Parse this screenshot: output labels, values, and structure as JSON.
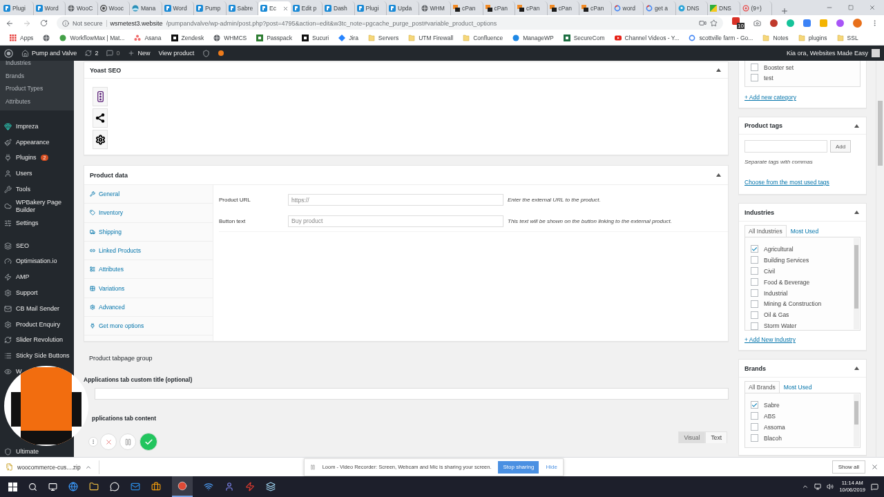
{
  "browser": {
    "tabs": [
      {
        "label": "Plugi",
        "kind": "p",
        "selected": false
      },
      {
        "label": "Word",
        "kind": "p",
        "selected": false
      },
      {
        "label": "WooC",
        "kind": "globe",
        "selected": false
      },
      {
        "label": "Wooc",
        "kind": "wp",
        "selected": false
      },
      {
        "label": "Mana",
        "kind": "disc",
        "selected": false
      },
      {
        "label": "Word",
        "kind": "p",
        "selected": false
      },
      {
        "label": "Pump",
        "kind": "p",
        "selected": false
      },
      {
        "label": "Sabre",
        "kind": "p",
        "selected": false
      },
      {
        "label": "Ec",
        "kind": "p",
        "selected": true
      },
      {
        "label": "Edit p",
        "kind": "p",
        "selected": false
      },
      {
        "label": "Dash",
        "kind": "p",
        "selected": false
      },
      {
        "label": "Plugi",
        "kind": "p",
        "selected": false
      },
      {
        "label": "Upda",
        "kind": "p",
        "selected": false
      },
      {
        "label": "WHM",
        "kind": "globe",
        "selected": false
      },
      {
        "label": "cPan",
        "kind": "cpanel",
        "selected": false
      },
      {
        "label": "cPan",
        "kind": "cpanel",
        "selected": false
      },
      {
        "label": "cPan",
        "kind": "cpanel",
        "selected": false
      },
      {
        "label": "cPan",
        "kind": "cpanel",
        "selected": false
      },
      {
        "label": "cPan",
        "kind": "cpanel",
        "selected": false
      },
      {
        "label": "word",
        "kind": "google",
        "selected": false
      },
      {
        "label": "get a",
        "kind": "google",
        "selected": false
      },
      {
        "label": "DNS",
        "kind": "pin",
        "selected": false
      },
      {
        "label": "DNS",
        "kind": "flag",
        "selected": false
      },
      {
        "label": "(9+)",
        "kind": "ring",
        "selected": false
      }
    ],
    "address": {
      "security": "Not secure",
      "host": "wsmetest3.website",
      "path": "/pumpandvalve/wp-admin/post.php?post=4795&action=edit&w3tc_note=pgcache_purge_post#variable_product_options"
    },
    "extension_badge": "10",
    "bookmarks": [
      {
        "label": "Apps",
        "kind": "grid",
        "color": "#e53935"
      },
      {
        "kind": "globe",
        "color": "#5f6368"
      },
      {
        "label": "WorkflowMax | Mat...",
        "kind": "dot",
        "color": "#43a047"
      },
      {
        "label": "Asana",
        "kind": "dots",
        "color": "#f06a6a"
      },
      {
        "label": "Zendesk",
        "kind": "square",
        "color": "#111111"
      },
      {
        "label": "WHMCS",
        "kind": "globe",
        "color": "#5f6368"
      },
      {
        "label": "Passpack",
        "kind": "square",
        "color": "#2e7d32"
      },
      {
        "label": "Sucuri",
        "kind": "square",
        "color": "#111111"
      },
      {
        "label": "Jira",
        "kind": "diamond",
        "color": "#2684ff"
      },
      {
        "label": "Servers",
        "kind": "folder",
        "color": "#f6d77a"
      },
      {
        "label": "UTM Firewall",
        "kind": "folder",
        "color": "#f6d77a"
      },
      {
        "label": "Confluence",
        "kind": "folder",
        "color": "#f6d77a"
      },
      {
        "label": "ManageWP",
        "kind": "dot",
        "color": "#1e88e5"
      },
      {
        "label": "SecureCom",
        "kind": "square",
        "color": "#1d6f42"
      },
      {
        "label": "Channel Videos - Y...",
        "kind": "play",
        "color": "#e62117"
      },
      {
        "label": "scottville farm - Go...",
        "kind": "google",
        "color": "#4285f4"
      },
      {
        "label": "Notes",
        "kind": "folder",
        "color": "#f6d77a"
      },
      {
        "label": "plugins",
        "kind": "folder",
        "color": "#f6d77a"
      },
      {
        "label": "SSL",
        "kind": "folder",
        "color": "#f6d77a"
      }
    ]
  },
  "admin_bar": {
    "site": "Pump and Valve",
    "updates": "2",
    "comments": "0",
    "new": "New",
    "view": "View product",
    "greeting": "Kia ora, Websites Made Easy"
  },
  "sidebar": {
    "submenu": [
      "Industries",
      "Brands",
      "Product Types",
      "Attributes"
    ],
    "items": [
      {
        "label": "Impreza"
      },
      {
        "label": "Appearance"
      },
      {
        "label": "Plugins",
        "badge": "2"
      },
      {
        "label": "Users"
      },
      {
        "label": "Tools"
      },
      {
        "label": "WPBakery Page Builder"
      },
      {
        "label": "Settings"
      },
      {
        "label": "SEO"
      },
      {
        "label": "Optimisation.io"
      },
      {
        "label": "AMP"
      },
      {
        "label": "Support"
      },
      {
        "label": "CB Mail Sender"
      },
      {
        "label": "Product Enquiry"
      },
      {
        "label": "Slider Revolution"
      },
      {
        "label": "Sticky Side Buttons"
      },
      {
        "label": "W"
      }
    ],
    "last_item": "Ultimate"
  },
  "yoast": {
    "title": "Yoast SEO"
  },
  "product_data": {
    "title": "Product data",
    "tabs": [
      "General",
      "Inventory",
      "Shipping",
      "Linked Products",
      "Attributes",
      "Variations",
      "Advanced",
      "Get more options"
    ],
    "fields": [
      {
        "label": "Product URL",
        "placeholder": "https://",
        "hint": "Enter the external URL to the product."
      },
      {
        "label": "Button text",
        "placeholder": "Buy product",
        "hint": "This text will be shown on the button linking to the external product."
      }
    ]
  },
  "tabpage_group": {
    "title": "Product tabpage group",
    "custom_title_label": "Applications tab custom title (optional)",
    "content_label": "pplications tab content",
    "editor_tabs": [
      {
        "label": "Visual",
        "selected": false
      },
      {
        "label": "Text",
        "selected": true
      }
    ]
  },
  "categories": {
    "items": [
      {
        "label": "Booster set",
        "checked": false
      },
      {
        "label": "test",
        "checked": false
      }
    ],
    "add_link": "+ Add new category"
  },
  "product_tags": {
    "title": "Product tags",
    "add": "Add",
    "hint": "Separate tags with commas",
    "link": "Choose from the most used tags"
  },
  "industries": {
    "title": "Industries",
    "tabs": [
      {
        "label": "All Industries",
        "selected": true
      },
      {
        "label": "Most Used",
        "selected": false
      }
    ],
    "items": [
      {
        "label": "Agricultural",
        "checked": true
      },
      {
        "label": "Building Services",
        "checked": false
      },
      {
        "label": "Civil",
        "checked": false
      },
      {
        "label": "Food & Beverage",
        "checked": false
      },
      {
        "label": "Industrial",
        "checked": false
      },
      {
        "label": "Mining & Construction",
        "checked": false
      },
      {
        "label": "Oil & Gas",
        "checked": false
      },
      {
        "label": "Storm Water",
        "checked": false
      }
    ],
    "add_link": "+ Add New Industry"
  },
  "brands": {
    "title": "Brands",
    "tabs": [
      {
        "label": "All Brands",
        "selected": true
      },
      {
        "label": "Most Used",
        "selected": false
      }
    ],
    "items": [
      {
        "label": "Sabre",
        "checked": true
      },
      {
        "label": "ABS",
        "checked": false
      },
      {
        "label": "Assoma",
        "checked": false
      },
      {
        "label": "Blacoh",
        "checked": false
      }
    ]
  },
  "download_bar": {
    "file": "woocommerce-cus....zip",
    "show_all": "Show all"
  },
  "loom_notice": {
    "message": "Loom - Video Recorder: Screen, Webcam and Mic is sharing your screen.",
    "stop": "Stop sharing",
    "hide": "Hide"
  },
  "taskbar": {
    "time": "11:14 AM",
    "date": "10/06/2019"
  }
}
